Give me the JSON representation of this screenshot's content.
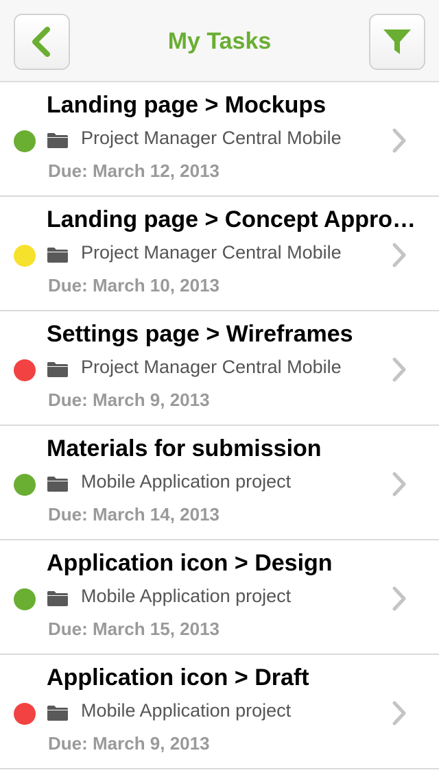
{
  "colors": {
    "accent": "#6aae32",
    "green": "#6aae32",
    "yellow": "#f6e22c",
    "red": "#f24242"
  },
  "navbar": {
    "title": "My Tasks",
    "back_icon": "chevron-left-icon",
    "filter_icon": "funnel-icon"
  },
  "tasks": [
    {
      "title": "Landing page > Mockups",
      "project": "Project Manager Central Mobile",
      "due": "Due: March 12, 2013",
      "status": "green"
    },
    {
      "title": "Landing page > Concept Approval",
      "project": "Project Manager Central Mobile",
      "due": "Due: March 10, 2013",
      "status": "yellow"
    },
    {
      "title": "Settings page > Wireframes",
      "project": "Project Manager Central Mobile",
      "due": "Due: March 9, 2013",
      "status": "red"
    },
    {
      "title": "Materials for submission",
      "project": "Mobile Application project",
      "due": "Due: March 14, 2013",
      "status": "green"
    },
    {
      "title": "Application icon > Design",
      "project": "Mobile Application project",
      "due": "Due: March 15, 2013",
      "status": "green"
    },
    {
      "title": "Application icon > Draft",
      "project": "Mobile Application project",
      "due": "Due: March 9, 2013",
      "status": "red"
    }
  ]
}
